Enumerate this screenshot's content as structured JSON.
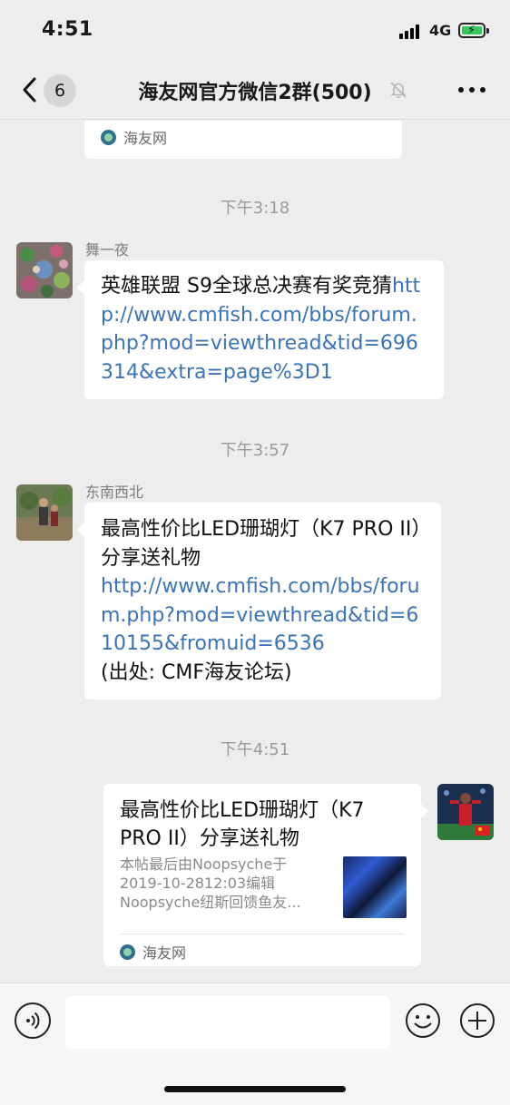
{
  "status_bar": {
    "time": "4:51",
    "network": "4G"
  },
  "nav": {
    "unread_count": "6",
    "title": "海友网官方微信2群(500)"
  },
  "messages": {
    "card_top": {
      "source": "海友网"
    },
    "ts1": "下午3:18",
    "m1": {
      "sender": "舞一夜",
      "text": "英雄联盟 S9全球总决赛有奖竞猜",
      "link": "http://www.cmfish.com/bbs/forum.php?mod=viewthread&tid=696314&extra=page%3D1"
    },
    "ts2": "下午3:57",
    "m2": {
      "sender": "东南西北",
      "text": "最高性价比LED珊瑚灯（K7 PRO II）分享送礼物",
      "link": "http://www.cmfish.com/bbs/forum.php?mod=viewthread&tid=610155&fromuid=6536",
      "suffix": "(出处: CMF海友论坛)"
    },
    "ts3": "下午4:51",
    "m3": {
      "title": "最高性价比LED珊瑚灯（K7 PRO II）分享送礼物",
      "desc": "本帖最后由Noopsyche于2019-10-2812:03编辑 Noopsyche纽斯回馈鱼友...",
      "source": "海友网"
    }
  },
  "input": {
    "placeholder": ""
  },
  "colors": {
    "link": "#3b73b8",
    "background": "#ededed",
    "bubble": "#ffffff"
  }
}
